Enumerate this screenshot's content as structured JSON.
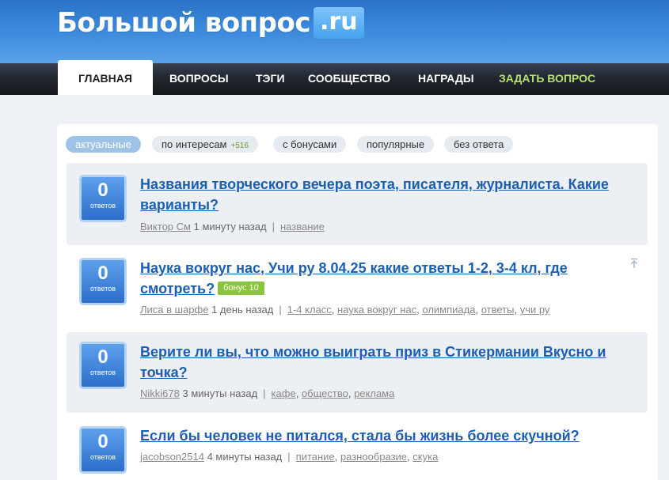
{
  "site": {
    "logo_text": "Большой вопрос",
    "logo_tld": ".ru"
  },
  "nav": {
    "items": [
      {
        "label": "ГЛАВНАЯ"
      },
      {
        "label": "ВОПРОСЫ"
      },
      {
        "label": "ТЭГИ"
      },
      {
        "label": "СООБЩЕСТВО"
      },
      {
        "label": "НАГРАДЫ"
      },
      {
        "label": "ЗАДАТЬ ВОПРОС"
      }
    ]
  },
  "filters": [
    {
      "label": "актуальные"
    },
    {
      "label": "по интересам",
      "count": "+516"
    },
    {
      "label": "с бонусами"
    },
    {
      "label": "популярные"
    },
    {
      "label": "без ответа"
    }
  ],
  "questions": [
    {
      "votes": "0",
      "votes_label": "ответов",
      "title": "Названия творческого вечера поэта, писателя, журналиста. Какие варианты?",
      "author": "Виктор См",
      "time": "1 минуту назад",
      "tags": [
        "название"
      ]
    },
    {
      "votes": "0",
      "votes_label": "ответов",
      "title": "Наука вокруг нас, Учи ру 8.04.25 какие ответы 1-2, 3-4 кл, где смотреть?",
      "bonus": "бонус 10",
      "author": "Лиса в шарфе",
      "time": "1 день назад",
      "tags": [
        "1-4 класс",
        "наука вокруг нас",
        "олимпиада",
        "ответы",
        "учи ру"
      ]
    },
    {
      "votes": "0",
      "votes_label": "ответов",
      "title": "Верите ли вы, что можно выиграть приз в Стикермании Вкусно и точка?",
      "author": "Nikki678",
      "time": "3 минуты назад",
      "tags": [
        "кафе",
        "общество",
        "реклама"
      ]
    },
    {
      "votes": "0",
      "votes_label": "ответов",
      "title": "Если бы человек не питался, стала бы жизнь более скучной?",
      "author": "jacobson2514",
      "time": "4 минуты назад",
      "tags": [
        "питание",
        "разнообразие",
        "скука"
      ]
    }
  ],
  "colors": {
    "header_blue": "#3f8cde",
    "nav_dark": "#22272f",
    "link_blue": "#1a5fb4",
    "ask_green": "#b6e06c",
    "bonus_green": "#8ac43c"
  },
  "icons": {
    "scroll_top": "arrow-up-to-line-icon"
  }
}
